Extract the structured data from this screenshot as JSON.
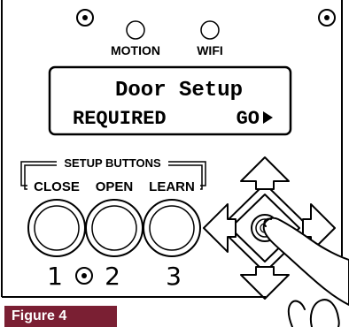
{
  "indicators": {
    "motion_label": "MOTION",
    "wifi_label": "WIFI"
  },
  "lcd": {
    "line1": "Door Setup",
    "line2_left": "REQUIRED",
    "line2_right": "GO"
  },
  "setup_buttons": {
    "group_label": "SETUP BUTTONS",
    "buttons": [
      {
        "label": "CLOSE",
        "number": "1"
      },
      {
        "label": "OPEN",
        "number": "2"
      },
      {
        "label": "LEARN",
        "number": "3"
      }
    ]
  },
  "dpad": {
    "icon": "four-way-arrow-pad",
    "press_indicator": "finger-pressing-center"
  },
  "figure": {
    "caption": "Figure 4",
    "badge_color": "#7a1f33"
  }
}
